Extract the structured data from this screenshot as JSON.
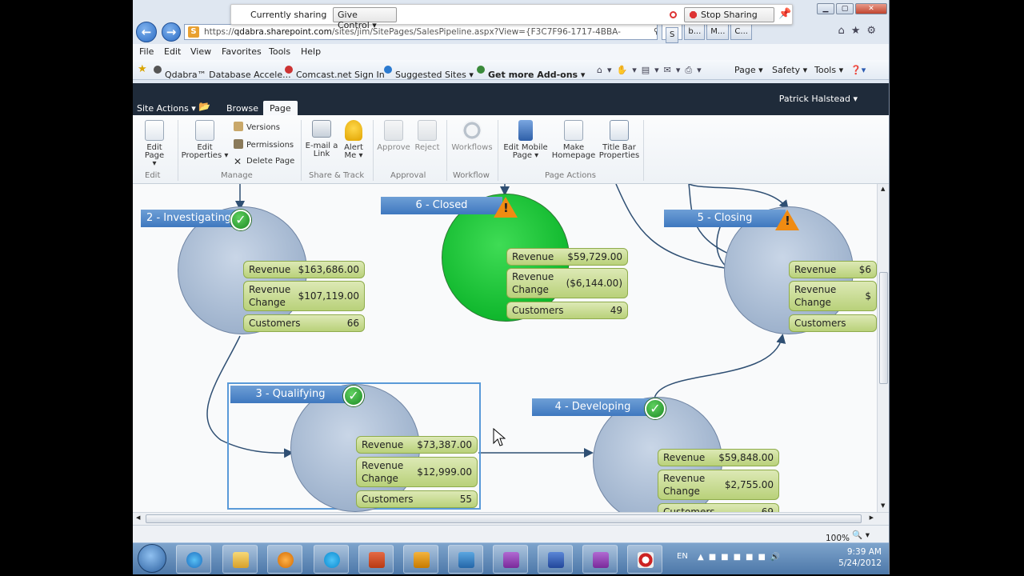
{
  "share_bar": {
    "status": "Currently sharing",
    "give_control": "Give Control",
    "stop_sharing": "Stop Sharing"
  },
  "address": {
    "url_prefix": "https://",
    "url_host": "qdabra.sharepoint.com",
    "url_path": "/sites/jim/SitePages/SalesPipeline.aspx?View={F3C7F96-1717-4BBA-",
    "tabs": [
      "S",
      "b...",
      "M...",
      "C..."
    ]
  },
  "menu": [
    "File",
    "Edit",
    "View",
    "Favorites",
    "Tools",
    "Help"
  ],
  "favorites": {
    "items": [
      "Qdabra™ Database Accele...",
      "Comcast.net Sign In",
      "Suggested Sites ▾",
      "Get more Add-ons ▾"
    ],
    "right_items": [
      "Page ▾",
      "Safety ▾",
      "Tools ▾"
    ]
  },
  "sharepoint": {
    "site_actions": "Site Actions ▾",
    "tab_browse": "Browse",
    "tab_page": "Page",
    "user": "Patrick Halstead ▾"
  },
  "ribbon": {
    "edit_page": "Edit Page",
    "edit_props_1": "Edit",
    "edit_props_2": "Properties ▾",
    "versions": "Versions",
    "permissions": "Permissions",
    "delete_page": "Delete Page",
    "email_1": "E-mail a",
    "email_2": "Link",
    "alert_1": "Alert",
    "alert_2": "Me ▾",
    "approve": "Approve",
    "reject": "Reject",
    "workflows": "Workflows",
    "mobile_1": "Edit Mobile",
    "mobile_2": "Page ▾",
    "home_1": "Make",
    "home_2": "Homepage",
    "title_1": "Title Bar",
    "title_2": "Properties",
    "groups": {
      "edit": "Edit",
      "manage": "Manage",
      "share": "Share & Track",
      "approval": "Approval",
      "workflow": "Workflow",
      "page_actions": "Page Actions"
    }
  },
  "stages": {
    "investigating": {
      "title": "2 - Investigating",
      "revenue": "$163,686.00",
      "revenue_change": "$107,119.00",
      "customers": "66"
    },
    "closed": {
      "title": "6 - Closed",
      "revenue": "$59,729.00",
      "revenue_change": "($6,144.00)",
      "customers": "49"
    },
    "closing": {
      "title": "5 - Closing",
      "revenue": "$6",
      "revenue_change": "$",
      "customers": ""
    },
    "qualifying": {
      "title": "3 - Qualifying",
      "revenue": "$73,387.00",
      "revenue_change": "$12,999.00",
      "customers": "55"
    },
    "developing": {
      "title": "4 - Developing",
      "revenue": "$59,848.00",
      "revenue_change": "$2,755.00",
      "customers": "69"
    }
  },
  "labels": {
    "revenue": "Revenue",
    "revenue_change_1": "Revenue",
    "revenue_change_2": "Change",
    "customers": "Customers"
  },
  "status": {
    "zoom": "100%"
  },
  "taskbar": {
    "lang": "EN",
    "time": "9:39 AM",
    "date": "5/24/2012"
  }
}
